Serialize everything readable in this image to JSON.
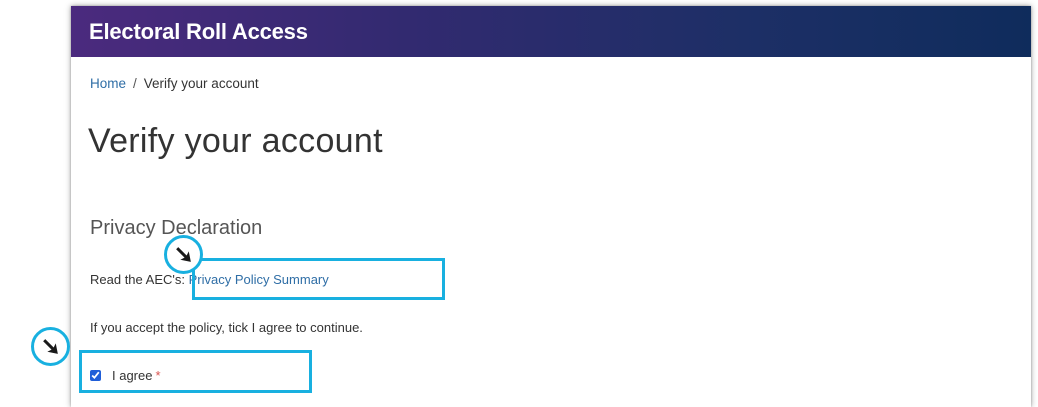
{
  "banner": {
    "title": "Electoral Roll Access"
  },
  "breadcrumb": {
    "home": "Home",
    "separator": "/",
    "current": "Verify your account"
  },
  "page": {
    "title": "Verify your account"
  },
  "privacy": {
    "heading": "Privacy Declaration",
    "read_prefix": "Read the AEC's:",
    "policy_link": "Privacy Policy Summary",
    "accept_text": "If you accept the policy, tick I agree to continue.",
    "agree_label": "I agree",
    "required_mark": "*",
    "agree_checked": true
  },
  "annotations": {
    "highlight_color": "#18b0e0",
    "marker_icon": "arrow-down-right-icon"
  },
  "colors": {
    "banner_gradient_start": "#4b2a7e",
    "banner_gradient_end": "#0f2c5c",
    "link": "#2f6ea6",
    "required": "#d9534f"
  }
}
